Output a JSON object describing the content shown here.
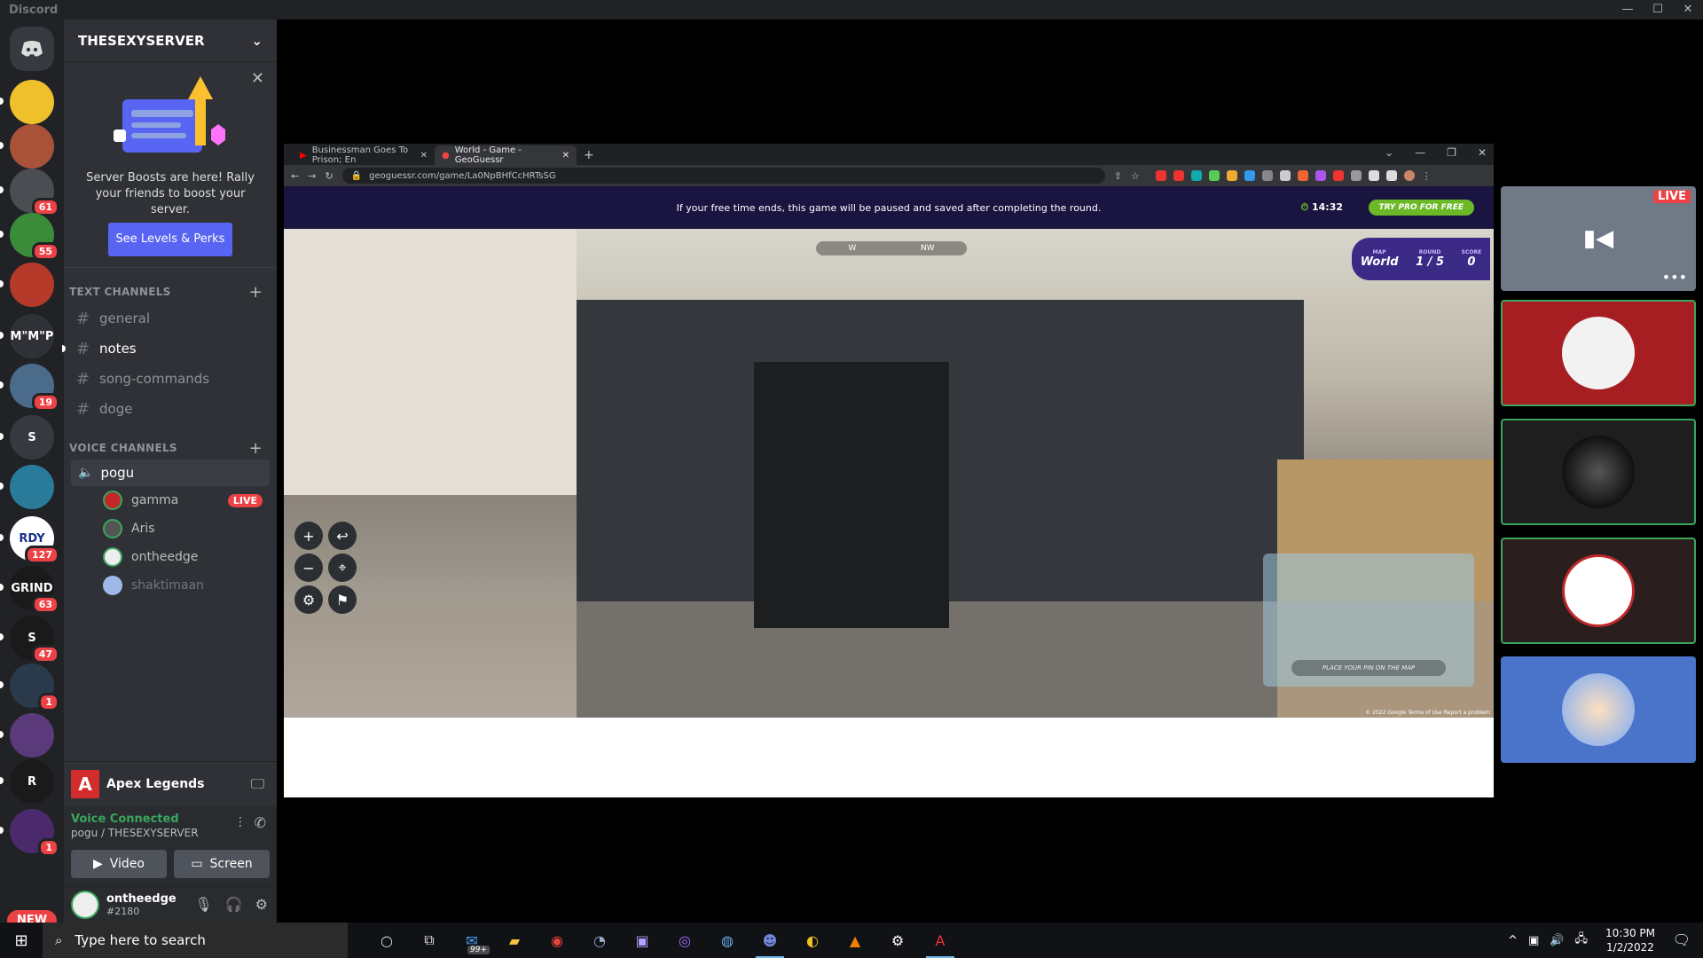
{
  "window": {
    "app_title": "Discord",
    "controls": [
      "—",
      "☐",
      "✕"
    ]
  },
  "server": {
    "name": "THESEXYSERVER"
  },
  "boost": {
    "text": "Server Boosts are here! Rally your friends to boost your server.",
    "button": "See Levels & Perks"
  },
  "guilds": [
    {
      "label": "",
      "color": "#f0c02c",
      "badge": ""
    },
    {
      "label": "",
      "color": "#a8523a",
      "badge": ""
    },
    {
      "label": "",
      "color": "#4a4d52",
      "badge": "61"
    },
    {
      "label": "",
      "color": "#3a8c3a",
      "badge": "55"
    },
    {
      "label": "",
      "color": "#b63a2a",
      "badge": ""
    },
    {
      "label": "M\"M\"P",
      "color": "#2f3136",
      "badge": ""
    },
    {
      "label": "",
      "color": "#4b6b8a",
      "badge": "19"
    },
    {
      "label": "S",
      "color": "#36393f",
      "badge": ""
    },
    {
      "label": "",
      "color": "#2a7a9a",
      "badge": ""
    },
    {
      "label": "RDY",
      "color": "#ffffff",
      "badge": "127"
    },
    {
      "label": "GRIND",
      "color": "#1a1a1a",
      "badge": "63"
    },
    {
      "label": "S",
      "color": "#1a1a1a",
      "badge": "47"
    },
    {
      "label": "",
      "color": "#2a3a4a",
      "badge": "1"
    },
    {
      "label": "",
      "color": "#5a3a7a",
      "badge": ""
    },
    {
      "label": "R",
      "color": "#1a1a1a",
      "badge": ""
    },
    {
      "label": "",
      "color": "#4a2a6a",
      "badge": "1"
    }
  ],
  "new_label": "NEW",
  "text_channels": {
    "header": "TEXT CHANNELS",
    "items": [
      "general",
      "notes",
      "song-commands",
      "doge"
    ]
  },
  "voice_channels": {
    "header": "VOICE CHANNELS",
    "channel": "pogu",
    "users": [
      {
        "name": "gamma",
        "live": "LIVE"
      },
      {
        "name": "Aris",
        "live": ""
      },
      {
        "name": "ontheedge",
        "live": ""
      },
      {
        "name": "shaktimaan",
        "live": ""
      }
    ]
  },
  "activity": {
    "game": "Apex Legends"
  },
  "voice_panel": {
    "status": "Voice Connected",
    "location": "pogu / THESEXYSERVER",
    "video": "Video",
    "screen": "Screen"
  },
  "user_panel": {
    "name": "ontheedge",
    "tag": "#2180"
  },
  "browser": {
    "tabs": [
      {
        "title": "Businessman Goes To Prison; En"
      },
      {
        "title": "World - Game - GeoGuessr"
      }
    ],
    "url": "geoguessr.com/game/La0NpBHfCcHRTsSG",
    "banner": "If your free time ends, this game will be paused and saved after completing the round.",
    "timer": "14:32",
    "pro_button": "TRY PRO FOR FREE",
    "compass": [
      "W",
      "NW"
    ],
    "map_label": "MAP",
    "round_label": "ROUND",
    "score_label": "SCORE",
    "map_value": "World",
    "round_value": "1 / 5",
    "score_value": "0",
    "pin_text": "PLACE YOUR PIN ON THE MAP",
    "attribution": "© 2022 Google  Terms of Use  Report a problem"
  },
  "tiles": {
    "live_label": "LIVE"
  },
  "taskbar": {
    "search_placeholder": "Type here to search",
    "badge": "99+",
    "time": "10:30 PM",
    "date": "1/2/2022"
  }
}
